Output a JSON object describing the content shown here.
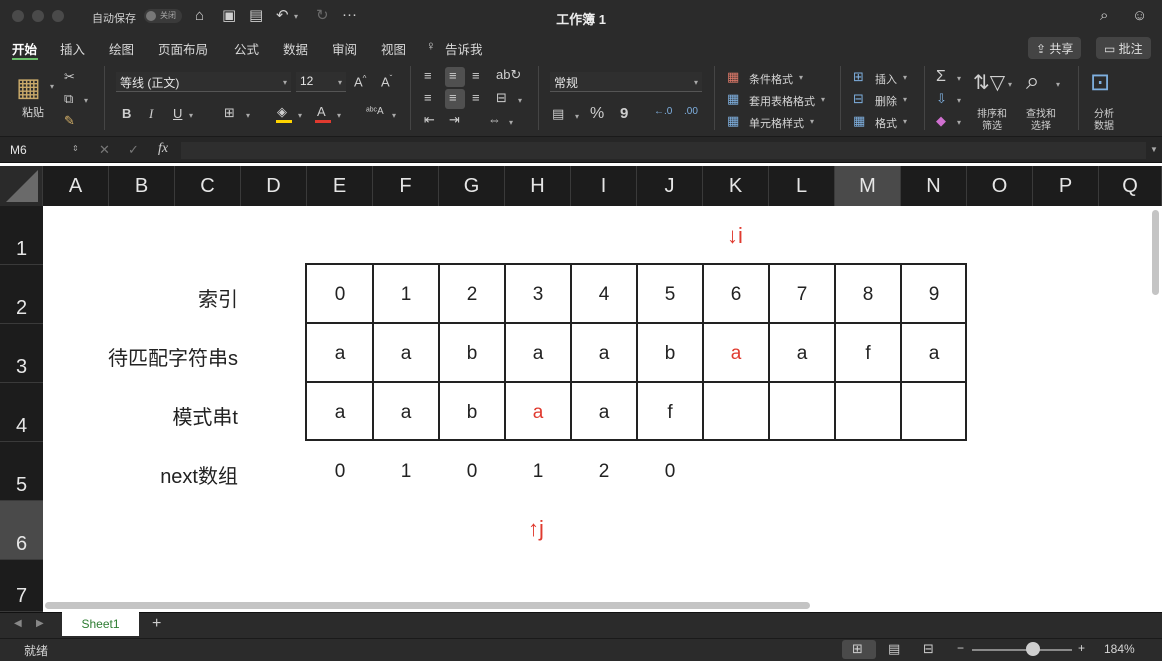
{
  "titlebar": {
    "autosave_label": "自动保存",
    "autosave_state": "关闭",
    "title": "工作簿 1",
    "more": "···"
  },
  "tabs": [
    "开始",
    "插入",
    "绘图",
    "页面布局",
    "公式",
    "数据",
    "审阅",
    "视图"
  ],
  "tell_me": "告诉我",
  "share_label": "共享",
  "comment_label": "批注",
  "ribbon": {
    "paste_label": "粘贴",
    "font_name": "等线 (正文)",
    "font_size": "12",
    "bold": "B",
    "italic": "I",
    "underline": "U",
    "number_format": "常规",
    "conditional_format": "条件格式",
    "table_format": "套用表格格式",
    "cell_style": "单元格样式",
    "insert": "插入",
    "delete": "删除",
    "format": "格式",
    "sort_filter_1": "排序和",
    "sort_filter_2": "筛选",
    "find_select_1": "查找和",
    "find_select_2": "选择",
    "analyze_1": "分析",
    "analyze_2": "数据",
    "percent": "%",
    "comma": "9"
  },
  "formula_bar": {
    "name_box": "M6",
    "fx": "fx",
    "formula": ""
  },
  "columns": [
    "A",
    "B",
    "C",
    "D",
    "E",
    "F",
    "G",
    "H",
    "I",
    "J",
    "K",
    "L",
    "M",
    "N",
    "O",
    "P",
    "Q"
  ],
  "selected_column": "M",
  "rows": [
    "1",
    "2",
    "3",
    "4",
    "5",
    "6",
    "7"
  ],
  "selected_row": "6",
  "sheet": {
    "labels": {
      "index": "索引",
      "text": "待匹配字符串s",
      "pattern": "模式串t",
      "next": "next数组"
    },
    "index_values": [
      "0",
      "1",
      "2",
      "3",
      "4",
      "5",
      "6",
      "7",
      "8",
      "9"
    ],
    "text_values": [
      "a",
      "a",
      "b",
      "a",
      "a",
      "b",
      "a",
      "a",
      "f",
      "a"
    ],
    "pattern_values": [
      "a",
      "a",
      "b",
      "a",
      "a",
      "f",
      "",
      "",
      "",
      ""
    ],
    "next_values": [
      "0",
      "1",
      "0",
      "1",
      "2",
      "0"
    ],
    "pointer_i": "↓i",
    "pointer_j": "↑j",
    "highlight_color": "#e03a2f"
  },
  "sheet_tabs": [
    "Sheet1"
  ],
  "add_sheet": "+",
  "status": {
    "ready": "就绪",
    "zoom": "184%",
    "zoom_out": "−",
    "zoom_in": "+"
  }
}
